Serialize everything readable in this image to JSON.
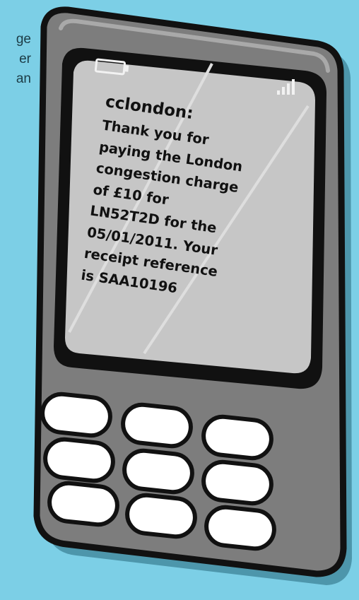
{
  "background_text": [
    "ge",
    "er",
    "an"
  ],
  "sms": {
    "sender": "cclondon:",
    "lines": [
      "Thank you for",
      "paying the London",
      "congestion charge",
      "of £10 for",
      "LN52T2D for the",
      "05/01/2011. Your",
      "receipt reference",
      "is SAA10196"
    ]
  },
  "keypad": {
    "rows": 3,
    "keys_per_row": 3
  },
  "icons": [
    "battery-icon",
    "signal-icon"
  ],
  "colors": {
    "background": "#7ccfe6",
    "phone_body": "#7d7d7d",
    "outline": "#111111",
    "screen": "#c6c6c6",
    "keys": "#ffffff"
  }
}
